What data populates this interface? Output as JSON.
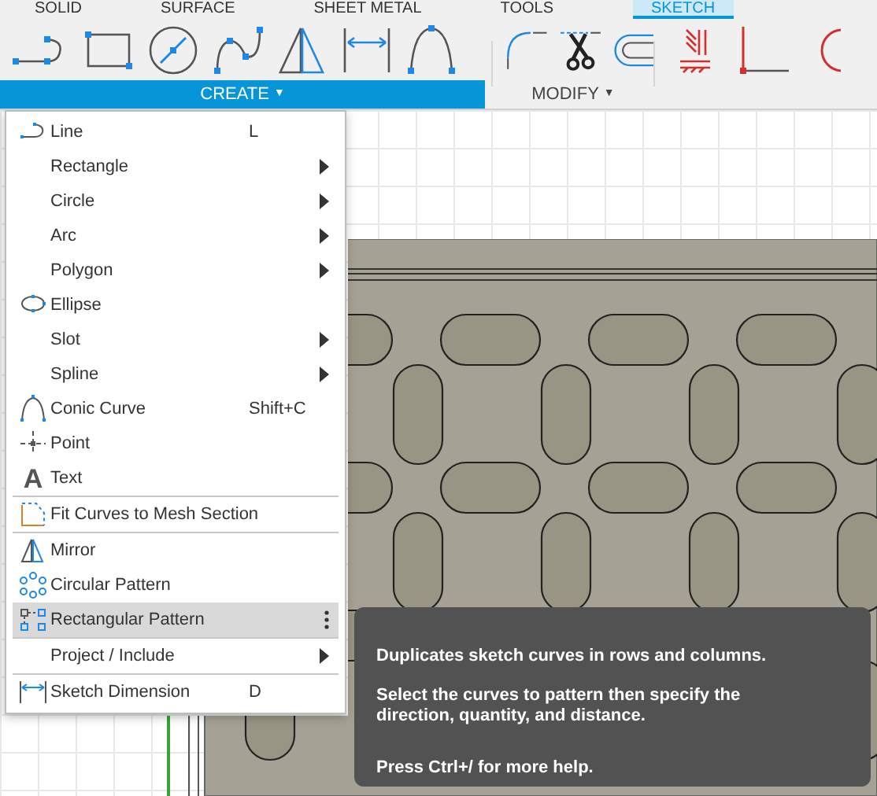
{
  "tabs": [
    {
      "label": "SOLID",
      "selected": false
    },
    {
      "label": "SURFACE",
      "selected": false
    },
    {
      "label": "SHEET METAL",
      "selected": false
    },
    {
      "label": "TOOLS",
      "selected": false
    },
    {
      "label": "SKETCH",
      "selected": true
    }
  ],
  "toolbar": {
    "groups": [
      {
        "label": "CREATE",
        "open": true,
        "caret": "▼"
      },
      {
        "label": "MODIFY",
        "open": false,
        "caret": "▼"
      }
    ]
  },
  "menu": {
    "items": [
      {
        "label": "Line",
        "kind": "line",
        "shortcut": "L",
        "submenu": false,
        "selected": false,
        "separator_before": false
      },
      {
        "label": "Rectangle",
        "submenu": true,
        "selected": false,
        "separator_before": false
      },
      {
        "label": "Circle",
        "submenu": true,
        "selected": false,
        "separator_before": false
      },
      {
        "label": "Arc",
        "submenu": true,
        "selected": false,
        "separator_before": false
      },
      {
        "label": "Polygon",
        "submenu": true,
        "selected": false,
        "separator_before": false
      },
      {
        "label": "Ellipse",
        "kind": "ellipse",
        "submenu": false,
        "selected": false,
        "separator_before": false
      },
      {
        "label": "Slot",
        "submenu": true,
        "selected": false,
        "separator_before": false
      },
      {
        "label": "Spline",
        "submenu": true,
        "selected": false,
        "separator_before": false
      },
      {
        "label": "Conic Curve",
        "kind": "conic",
        "shortcut": "Shift+C",
        "submenu": false,
        "selected": false,
        "separator_before": false
      },
      {
        "label": "Point",
        "kind": "point",
        "submenu": false,
        "selected": false,
        "separator_before": false
      },
      {
        "label": "Text",
        "kind": "glyph",
        "icon_glyph": "A",
        "submenu": false,
        "selected": false,
        "separator_before": false
      },
      {
        "label": "Fit Curves to Mesh Section",
        "kind": "fit",
        "submenu": false,
        "selected": false,
        "separator_before": true
      },
      {
        "label": "Mirror",
        "kind": "mirror",
        "submenu": false,
        "selected": false,
        "separator_before": true
      },
      {
        "label": "Circular Pattern",
        "kind": "circular",
        "submenu": false,
        "selected": false,
        "separator_before": false
      },
      {
        "label": "Rectangular Pattern",
        "kind": "rectangular",
        "submenu": false,
        "selected": true,
        "separator_before": false
      },
      {
        "label": "Project / Include",
        "submenu": true,
        "selected": false,
        "separator_before": true
      },
      {
        "label": "Sketch Dimension",
        "kind": "dimension",
        "shortcut": "D",
        "submenu": false,
        "selected": false,
        "separator_before": true
      }
    ]
  },
  "tooltip": {
    "paragraphs": [
      "Duplicates sketch curves in rows and columns.",
      "Select the curves to pattern then specify the direction, quantity, and distance.",
      "Press Ctrl+/ for more help."
    ]
  }
}
